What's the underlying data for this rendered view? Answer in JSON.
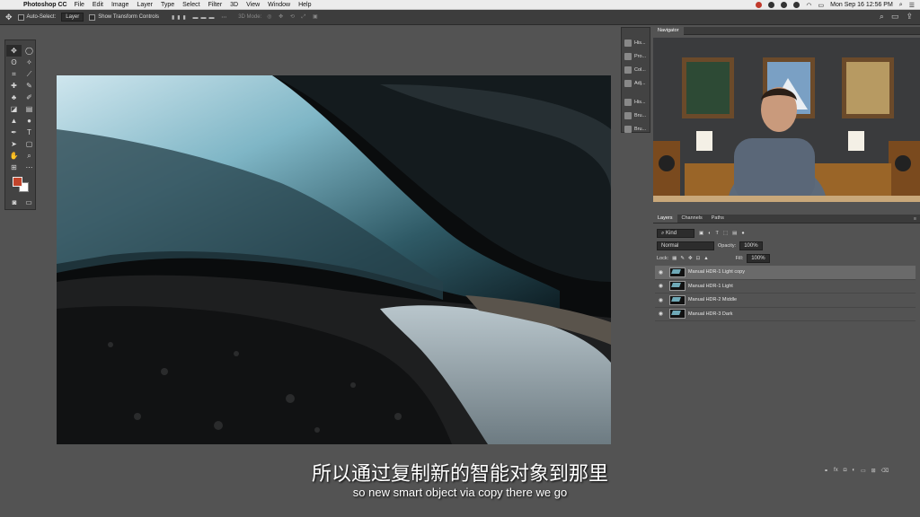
{
  "menubar": {
    "app_name": "Photoshop CC",
    "items": [
      "File",
      "Edit",
      "Image",
      "Layer",
      "Type",
      "Select",
      "Filter",
      "3D",
      "View",
      "Window",
      "Help"
    ],
    "clock": "Mon Sep 16  12:56 PM"
  },
  "options_bar": {
    "auto_select_label": "Auto-Select:",
    "auto_select_value": "Layer",
    "transform_label": "Show Transform Controls",
    "mode_3d": "3D Mode:"
  },
  "panel_strip": {
    "items": [
      "His...",
      "Pro...",
      "Col...",
      "Adj...",
      "His...",
      "Bru...",
      "Bru..."
    ]
  },
  "navigator": {
    "tab": "Navigator"
  },
  "layers_panel": {
    "tabs": [
      "Layers",
      "Channels",
      "Paths"
    ],
    "filter_kind": "Kind",
    "blend_mode": "Normal",
    "opacity_label": "Opacity:",
    "opacity_value": "100%",
    "lock_label": "Lock:",
    "fill_label": "Fill:",
    "fill_value": "100%",
    "layers": [
      {
        "name": "Manual HDR-1 Light copy",
        "selected": true
      },
      {
        "name": "Manual HDR-1 Light",
        "selected": false
      },
      {
        "name": "Manual HDR-2 Middle",
        "selected": false
      },
      {
        "name": "Manual HDR-3 Dark",
        "selected": false
      }
    ],
    "footer_icons": [
      "link-icon",
      "fx-icon",
      "mask-icon",
      "adjustment-icon",
      "group-icon",
      "new-layer-icon",
      "trash-icon"
    ]
  },
  "subtitles": {
    "chinese": "所以通过复制新的智能对象到那里",
    "english": "so new smart object via copy there we go"
  },
  "colors": {
    "foreground": "#c3452c",
    "background": "#ffffff"
  }
}
